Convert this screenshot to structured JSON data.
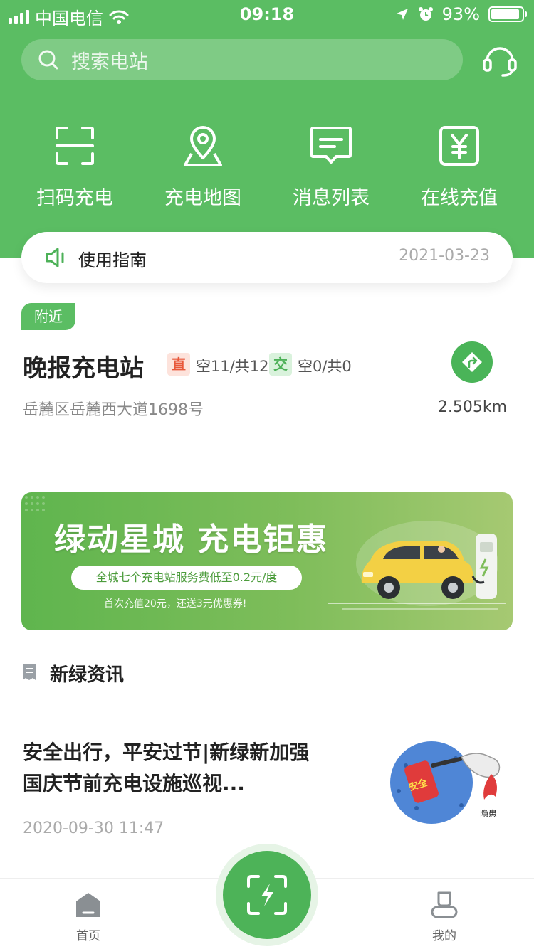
{
  "status_bar": {
    "carrier": "中国电信",
    "time": "09:18",
    "battery": "93%",
    "battery_level": 0.93
  },
  "search": {
    "placeholder": "搜索电站",
    "icon": "search-icon"
  },
  "header": {
    "customer_service_icon": "headset-icon"
  },
  "quick_actions": [
    {
      "label": "扫码充电",
      "icon": "scan-icon"
    },
    {
      "label": "充电地图",
      "icon": "map-pin-icon"
    },
    {
      "label": "消息列表",
      "icon": "message-icon"
    },
    {
      "label": "在线充值",
      "icon": "yuan-icon"
    }
  ],
  "notice": {
    "title": "使用指南",
    "date": "2021-03-23",
    "icon": "speaker-icon"
  },
  "nearby": {
    "tag": "附近",
    "station": {
      "name": "晚报充电站",
      "dc_badge": "直",
      "dc_status": "空11/共12",
      "ac_badge": "交",
      "ac_status": "空0/共0",
      "address": "岳麓区岳麓西大道1698号",
      "distance": "2.505km",
      "nav_icon": "navigation-icon"
    }
  },
  "banner": {
    "title": "绿动星城  充电钜惠",
    "pill": "全城七个充电站服务费低至0.2元/度",
    "note": "首次充值20元，还送3元优惠券!"
  },
  "news": {
    "section_title": "新绿资讯",
    "items": [
      {
        "title": "安全出行，平安过节|新绿新加强国庆节前充电设施巡视...",
        "time": "2020-09-30 11:47",
        "thumb_text_1": "安全",
        "thumb_text_2": "隐患"
      }
    ]
  },
  "tabbar": {
    "home": "首页",
    "mine": "我的",
    "scan_icon": "scan-charge-icon"
  },
  "colors": {
    "brand_green": "#5bbd63",
    "dc_red": "#e8573a",
    "ac_green": "#4db158"
  }
}
